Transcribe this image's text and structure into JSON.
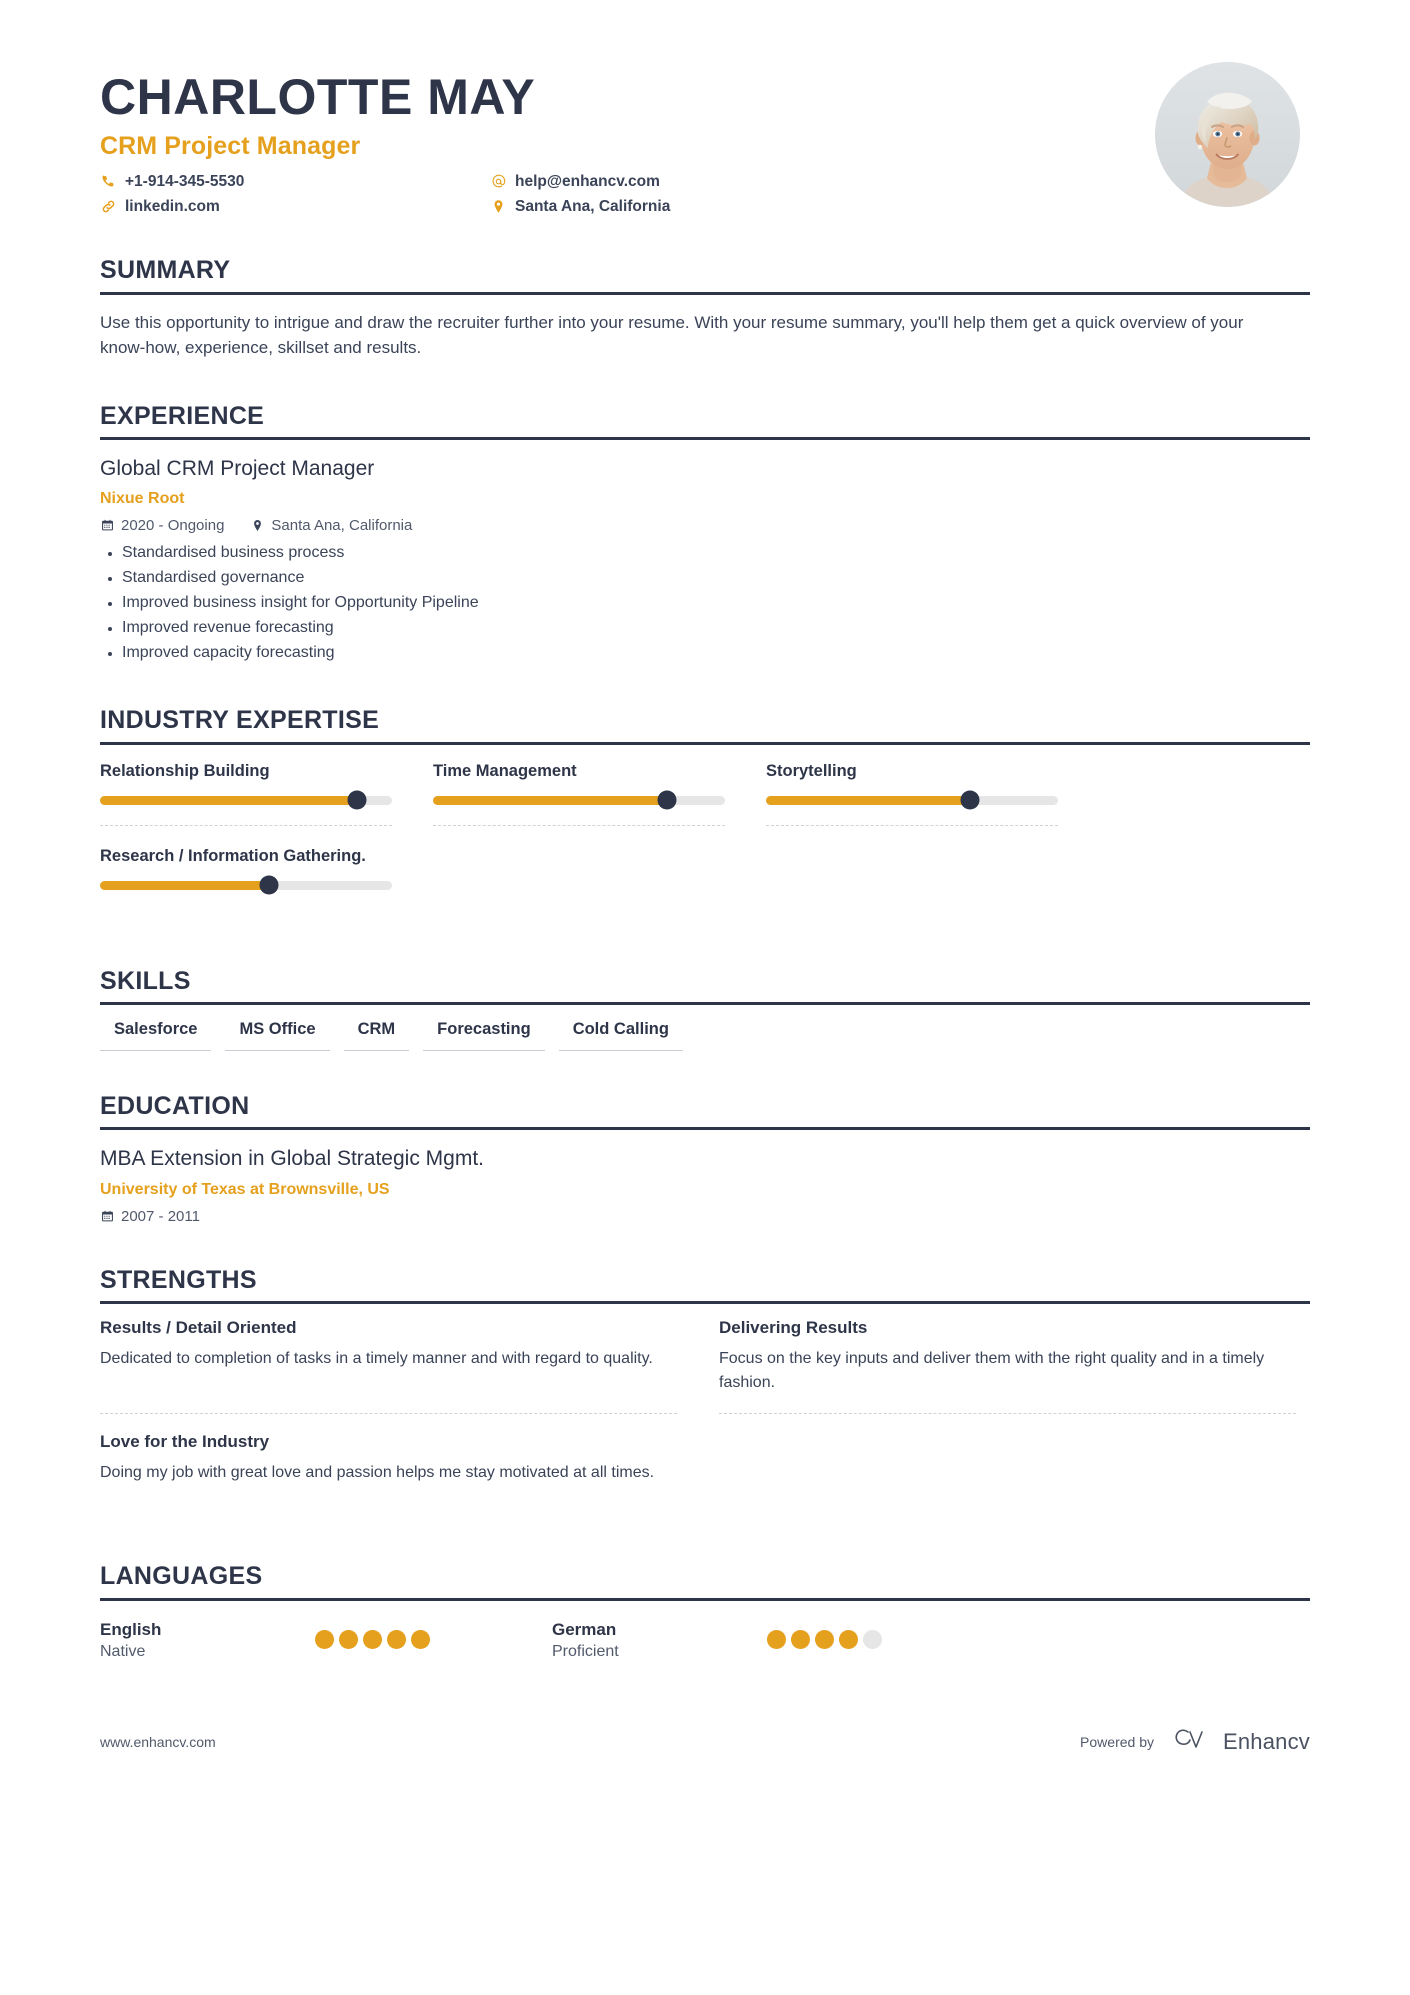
{
  "accent_color": "#e5a01e",
  "dark_color": "#2e3549",
  "header": {
    "full_name": "CHARLOTTE MAY",
    "job_title": "CRM Project Manager",
    "contacts": [
      {
        "icon": "phone-icon",
        "text": "+1-914-345-5530"
      },
      {
        "icon": "link-icon",
        "text": "linkedin.com"
      },
      {
        "icon": "at-icon",
        "text": "help@enhancv.com"
      },
      {
        "icon": "location-pin-icon",
        "text": "Santa Ana, California"
      }
    ]
  },
  "sections": {
    "summary": {
      "title": "SUMMARY",
      "text": "Use this opportunity to intrigue and draw the recruiter further into your resume. With your resume summary, you'll help them get a quick overview of your know-how, experience, skillset and results."
    },
    "experience": {
      "title": "EXPERIENCE",
      "entries": [
        {
          "role": "Global CRM Project Manager",
          "company": "Nixue Root",
          "dates": "2020 - Ongoing",
          "location": "Santa Ana, California",
          "bullets": [
            "Standardised business process",
            "Standardised governance",
            "Improved business insight for Opportunity Pipeline",
            "Improved revenue forecasting",
            "Improved capacity forecasting"
          ]
        }
      ]
    },
    "industry_expertise": {
      "title": "INDUSTRY EXPERTISE",
      "items": [
        {
          "label": "Relationship Building",
          "value": 88
        },
        {
          "label": "Time Management",
          "value": 80
        },
        {
          "label": "Storytelling",
          "value": 70
        },
        {
          "label": "Research / Information Gathering.",
          "value": 58
        }
      ]
    },
    "skills": {
      "title": "SKILLS",
      "items": [
        "Salesforce",
        "MS Office",
        "CRM",
        "Forecasting",
        "Cold Calling"
      ]
    },
    "education": {
      "title": "EDUCATION",
      "entries": [
        {
          "degree": "MBA Extension in Global Strategic Mgmt.",
          "school": "University of Texas at Brownsville, US",
          "dates": "2007 - 2011"
        }
      ]
    },
    "strengths": {
      "title": "STRENGTHS",
      "items": [
        {
          "title": "Results / Detail Oriented",
          "description": "Dedicated to completion of tasks in a timely manner and with regard to quality."
        },
        {
          "title": "Delivering Results",
          "description": "Focus on the key inputs and deliver them with the right quality and in a timely fashion."
        },
        {
          "title": "Love for the Industry",
          "description": "Doing my job with great love and passion helps me stay motivated at all times."
        }
      ]
    },
    "languages": {
      "title": "LANGUAGES",
      "items": [
        {
          "name": "English",
          "level": "Native",
          "dots_filled": 5,
          "dots_total": 5
        },
        {
          "name": "German",
          "level": "Proficient",
          "dots_filled": 4,
          "dots_total": 5
        }
      ]
    }
  },
  "footer": {
    "url": "www.enhancv.com",
    "powered_by": "Powered by",
    "brand": "Enhancv"
  }
}
